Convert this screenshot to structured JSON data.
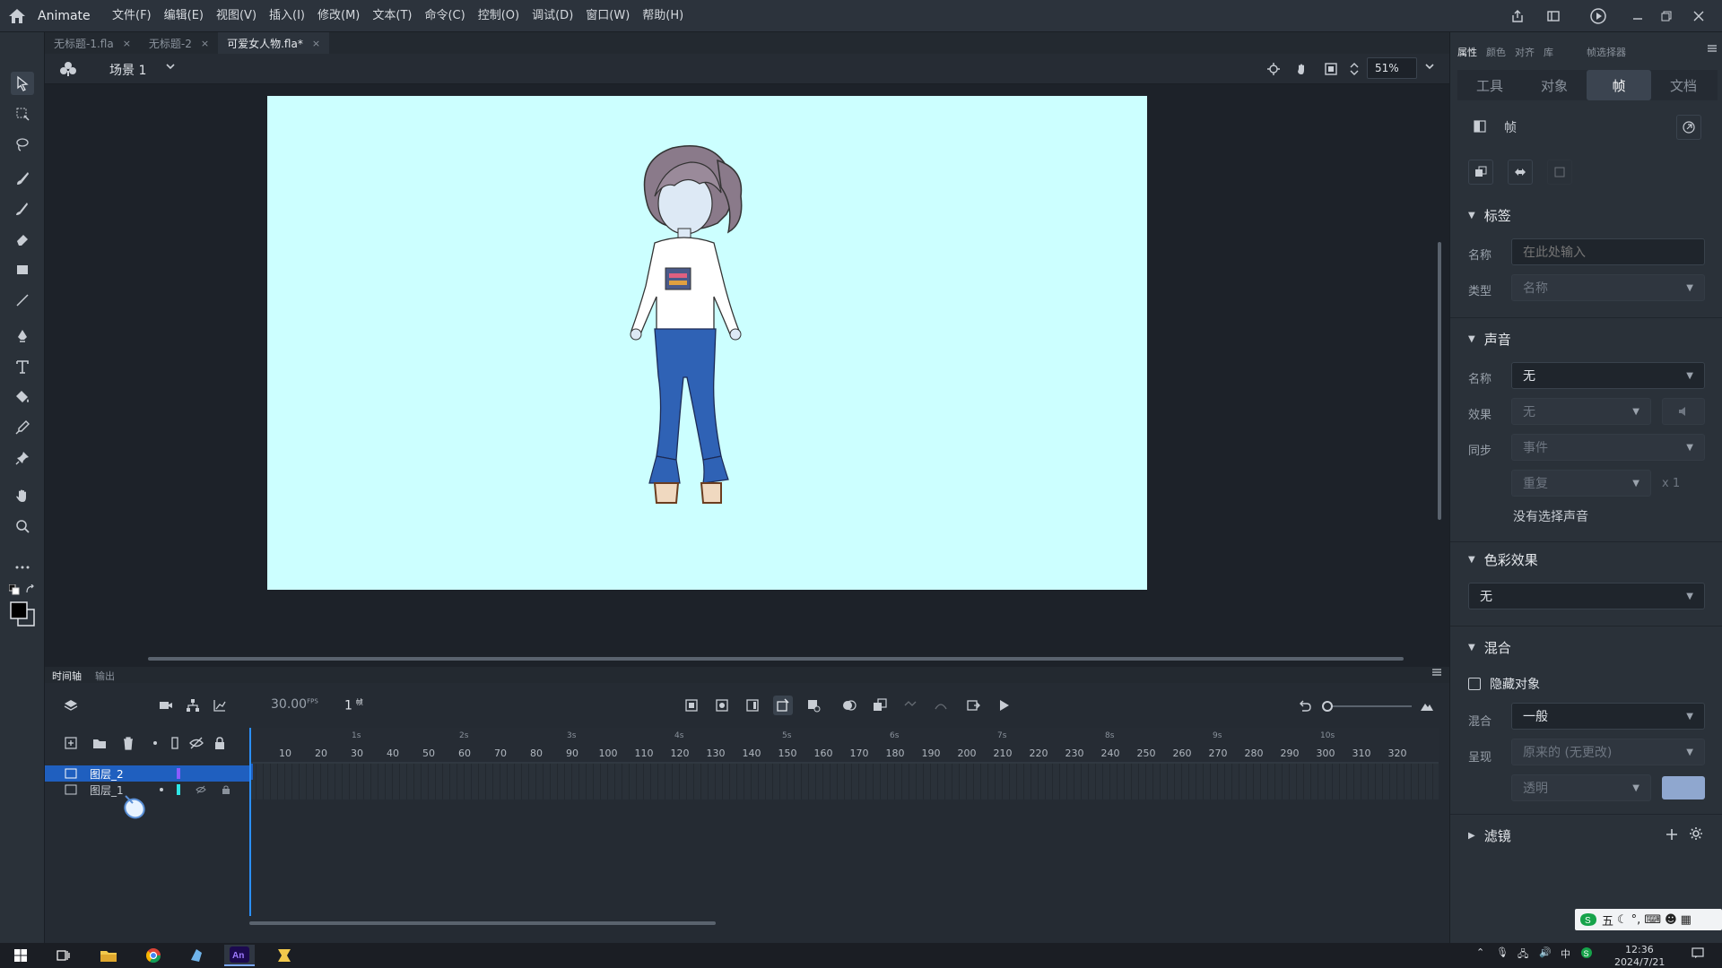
{
  "app": {
    "name": "Animate"
  },
  "menu": [
    "文件(F)",
    "编辑(E)",
    "视图(V)",
    "插入(I)",
    "修改(M)",
    "文本(T)",
    "命令(C)",
    "控制(O)",
    "调试(D)",
    "窗口(W)",
    "帮助(H)"
  ],
  "doc_tabs": [
    {
      "label": "无标题-1.fla",
      "close": "×"
    },
    {
      "label": "无标题-2",
      "close": "×"
    },
    {
      "label": "可爱女人物.fla*",
      "close": "×"
    }
  ],
  "scene": {
    "label": "场景 1",
    "zoom": "51%"
  },
  "timeline": {
    "tabs": [
      "时间轴",
      "输出"
    ],
    "fps": "30.00",
    "fps_unit": "FPS",
    "frame": "1",
    "frame_unit": "帧",
    "ruler_numbers": [
      "10",
      "20",
      "30",
      "40",
      "50",
      "60",
      "70",
      "80",
      "90",
      "100",
      "110",
      "120",
      "130",
      "140",
      "150",
      "160",
      "170",
      "180",
      "190",
      "200",
      "210",
      "220",
      "230",
      "240",
      "250",
      "260",
      "270",
      "280",
      "290",
      "300",
      "310",
      "320"
    ],
    "ruler_seconds": [
      "1s",
      "2s",
      "3s",
      "4s",
      "5s",
      "6s",
      "7s",
      "8s",
      "9s",
      "10s"
    ],
    "layers": [
      {
        "name": "图层_2",
        "selected": true
      },
      {
        "name": "图层_1",
        "selected": false
      }
    ]
  },
  "properties": {
    "tabs": [
      "属性",
      "颜色",
      "对齐",
      "库",
      "帧选择器"
    ],
    "segments": [
      "工具",
      "对象",
      "帧",
      "文档"
    ],
    "active_segment": "帧",
    "section_title": "帧",
    "label_section": {
      "title": "标签",
      "name_label": "名称",
      "name_placeholder": "在此处输入",
      "type_label": "类型",
      "type_value": "名称"
    },
    "sound_section": {
      "title": "声音",
      "name_label": "名称",
      "name_value": "无",
      "effect_label": "效果",
      "effect_value": "无",
      "sync_label": "同步",
      "sync_value": "事件",
      "repeat_value": "重复",
      "repeat_count": "x 1",
      "no_sound": "没有选择声音"
    },
    "color_section": {
      "title": "色彩效果",
      "value": "无"
    },
    "blend_section": {
      "title": "混合",
      "hide_label": "隐藏对象",
      "blend_label": "混合",
      "blend_value": "一般",
      "render_label": "呈现",
      "render_value": "原来的 (无更改)",
      "transparent_value": "透明"
    },
    "filter_section": {
      "title": "滤镜"
    }
  },
  "taskbar": {
    "time": "12:36",
    "date": "2024/7/21",
    "ime_lang": "中",
    "ime_mode": "五"
  },
  "colors": {
    "stage": "#ccffff",
    "accent": "#1f5fbf",
    "layer2_color": "#8a5cff",
    "layer1_color": "#2ee6e6"
  }
}
